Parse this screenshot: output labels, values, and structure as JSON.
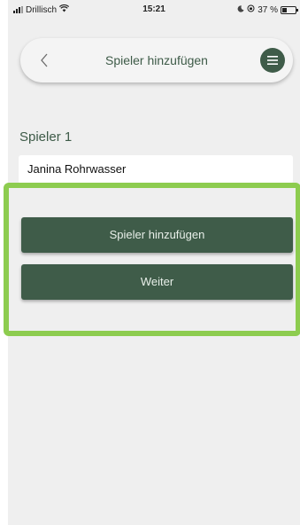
{
  "status_bar": {
    "carrier": "Drillisch",
    "time": "15:21",
    "battery_percent": "37 %",
    "battery_level": 0.37,
    "icons": [
      "signal-icon",
      "wifi-icon",
      "moon-icon",
      "rotation-lock-icon",
      "battery-icon"
    ]
  },
  "nav": {
    "title": "Spieler hinzufügen",
    "back_icon": "chevron-left-icon",
    "menu_icon": "hamburger-menu-icon"
  },
  "players": [
    {
      "label": "Spieler 1",
      "value": "Janina Rohrwasser"
    }
  ],
  "actions": {
    "add_player_label": "Spieler hinzufügen",
    "next_label": "Weiter"
  },
  "colors": {
    "primary": "#3f5c49",
    "highlight": "#8dcc4f",
    "background": "#efefef"
  }
}
